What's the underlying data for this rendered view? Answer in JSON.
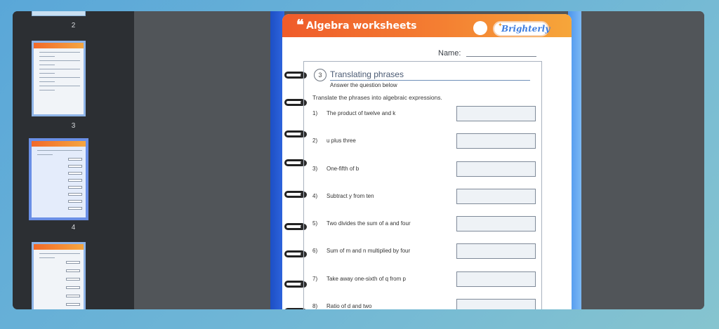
{
  "sidebar": {
    "pages": [
      {
        "label": "2"
      },
      {
        "label": "3"
      },
      {
        "label": "4",
        "selected": true
      },
      {
        "label": ""
      }
    ]
  },
  "worksheet": {
    "header_title": "Algebra worksheets",
    "brand": "Brighterly",
    "name_label": "Name:",
    "question_number": "3",
    "question_title": "Translating phrases",
    "question_subtitle": "Answer the question below",
    "instruction": "Translate the phrases into algebraic expressions.",
    "items": [
      {
        "num": "1)",
        "text": "The product of twelve and k"
      },
      {
        "num": "2)",
        "text": "u plus three"
      },
      {
        "num": "3)",
        "text": "One-fifth of b"
      },
      {
        "num": "4)",
        "text": "Subtract y from ten"
      },
      {
        "num": "5)",
        "text": "Two divides the sum of a and four"
      },
      {
        "num": "6)",
        "text": "Sum of m and n multiplied by four"
      },
      {
        "num": "7)",
        "text": "Take away one-sixth of q from p"
      },
      {
        "num": "8)",
        "text": "Ratio of d and two"
      }
    ]
  },
  "colors": {
    "header_start": "#ef5b2a",
    "header_end": "#f6a63a",
    "spine": "#2f66e0",
    "thumb_selected_border": "#6a8fe6",
    "background": "#5aa7d8"
  }
}
